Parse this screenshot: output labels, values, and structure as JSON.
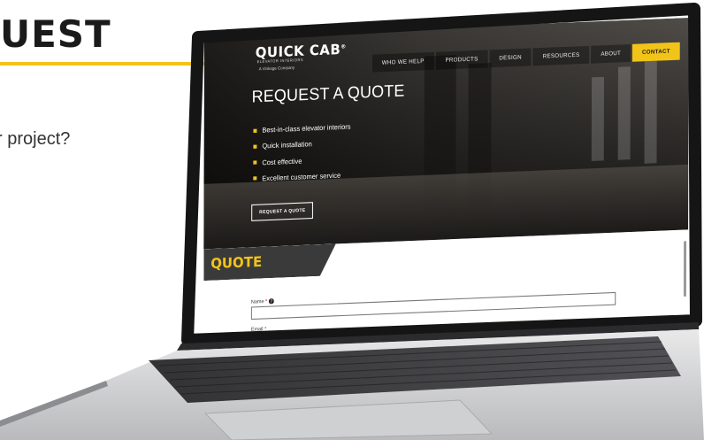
{
  "background_page": {
    "heading_fragment": "UEST",
    "question_fragment": "r project?"
  },
  "site": {
    "logo": "QUICK CAB",
    "logo_registered": "®",
    "logo_sub": "ELEVATOR INTERIORS",
    "logo_tag": "A Vinkage Company",
    "nav": [
      "WHO WE HELP",
      "PRODUCTS",
      "DESIGN",
      "RESOURCES",
      "ABOUT",
      "CONTACT"
    ],
    "hero_title": "REQUEST A QUOTE",
    "bullets": [
      "Best-in-class elevator interiors",
      "Quick installation",
      "Cost effective",
      "Excellent customer service"
    ],
    "cta_button": "REQUEST A QUOTE",
    "section_title": "QUOTE",
    "form": {
      "name_label": "Name",
      "email_label": "Email",
      "required_marker": "*"
    }
  },
  "colors": {
    "accent": "#f2c418",
    "dark_band": "#3a3a3a"
  },
  "icons": {
    "name_help": "question-circle-icon"
  }
}
